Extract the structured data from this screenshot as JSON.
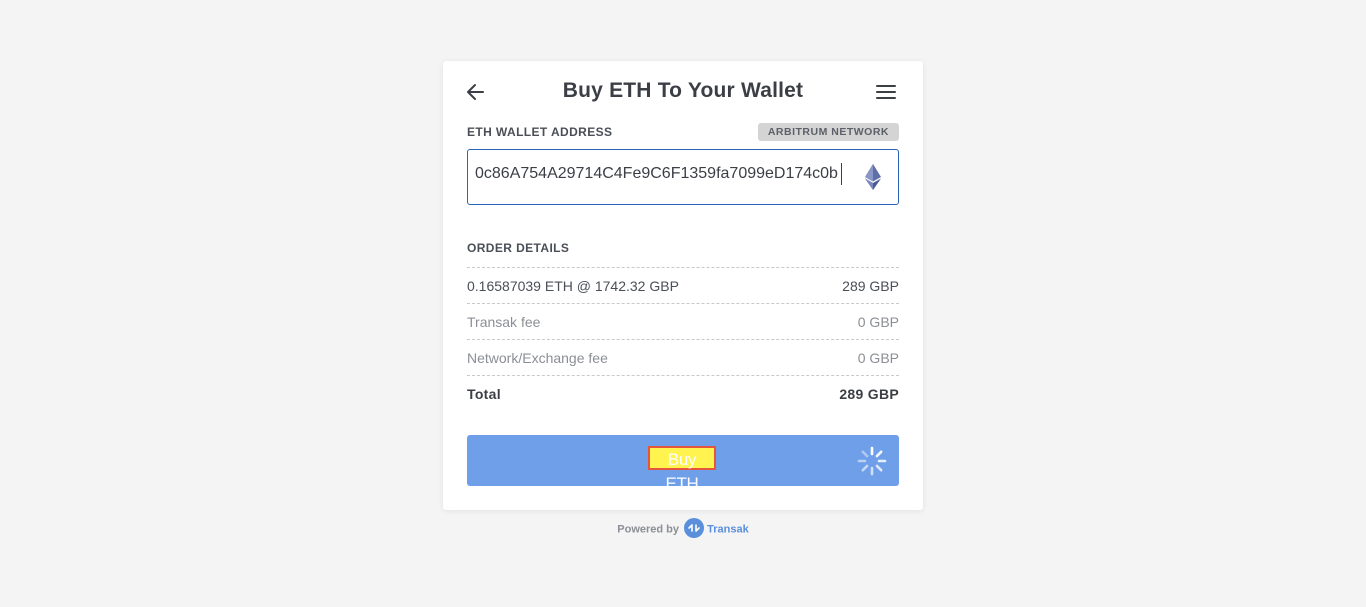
{
  "header": {
    "title": "Buy ETH To Your Wallet",
    "back_icon": "arrow-left-icon",
    "menu_icon": "hamburger-menu-icon"
  },
  "wallet": {
    "label": "ETH WALLET ADDRESS",
    "network_badge": "ARBITRUM NETWORK",
    "address": "0c86A754A29714C4Fe9C6F1359fa7099eD174c0b",
    "currency_icon": "ethereum-icon"
  },
  "order": {
    "section_label": "ORDER DETAILS",
    "rows": [
      {
        "label": "0.16587039 ETH @ 1742.32 GBP",
        "value": "289 GBP"
      },
      {
        "label": "Transak fee",
        "value": "0 GBP"
      },
      {
        "label": "Network/Exchange fee",
        "value": "0 GBP"
      },
      {
        "label": "Total",
        "value": "289 GBP"
      }
    ]
  },
  "buy_button": {
    "label": "Buy ETH",
    "loading_icon": "spinner-icon"
  },
  "footer": {
    "powered_by": "Powered by",
    "brand": "Transak",
    "brand_icon": "transak-logo-icon"
  },
  "colors": {
    "accent": "#2a63b8",
    "button": "#6f9fe8",
    "highlight": "#fff44f",
    "highlight_border": "#e5553c",
    "background": "#f4f4f4"
  }
}
